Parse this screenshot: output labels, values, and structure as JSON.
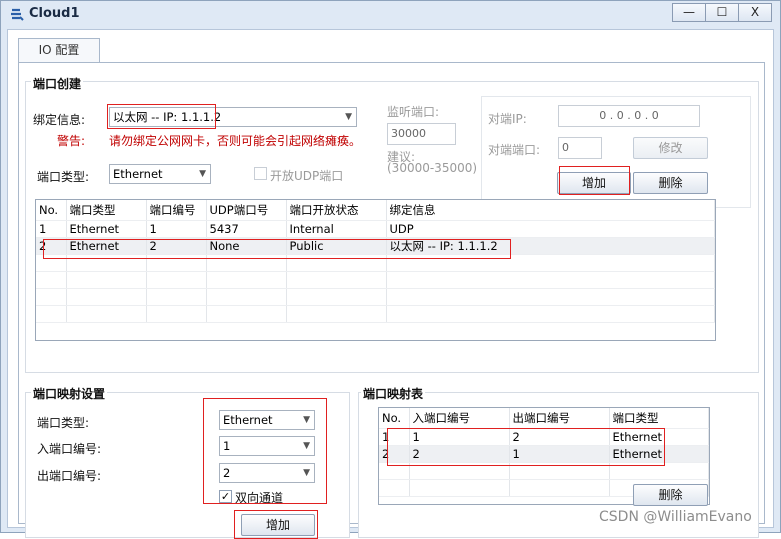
{
  "window": {
    "title": "Cloud1",
    "minimize": "—",
    "maximize": "☐",
    "close": "X"
  },
  "tab": {
    "label": "IO 配置"
  },
  "port_create": {
    "title": "端口创建",
    "bind_label": "绑定信息:",
    "bind_value": "以太网 -- IP: 1.1.1.2",
    "warning_label": "警告:",
    "warning_text": "请勿绑定公网网卡，否则可能会引起网络瘫痪。",
    "port_type_label": "端口类型:",
    "port_type_value": "Ethernet",
    "udp_open_label": "开放UDP端口",
    "listen_label": "监听端口:",
    "listen_value": "30000",
    "suggest_label": "建议:",
    "suggest_range": "(30000-35000)",
    "peer_ip_label": "对端IP:",
    "peer_ip_value": "0 . 0 . 0 . 0",
    "peer_port_label": "对端端口:",
    "peer_port_value": "0",
    "modify_label": "修改",
    "add_label": "增加",
    "delete_label": "删除",
    "table": {
      "headers": [
        "No.",
        "端口类型",
        "端口编号",
        "UDP端口号",
        "端口开放状态",
        "绑定信息"
      ],
      "rows": [
        [
          "1",
          "Ethernet",
          "1",
          "5437",
          "Internal",
          "UDP"
        ],
        [
          "2",
          "Ethernet",
          "2",
          "None",
          "Public",
          "以太网 -- IP: 1.1.1.2"
        ]
      ]
    }
  },
  "mapping_settings": {
    "title": "端口映射设置",
    "port_type_label": "端口类型:",
    "port_type_value": "Ethernet",
    "in_label": "入端口编号:",
    "in_value": "1",
    "out_label": "出端口编号:",
    "out_value": "2",
    "bidirectional_label": "双向通道",
    "add_label": "增加"
  },
  "mapping_table": {
    "title": "端口映射表",
    "headers": [
      "No.",
      "入端口编号",
      "出端口编号",
      "端口类型"
    ],
    "rows": [
      [
        "1",
        "1",
        "2",
        "Ethernet"
      ],
      [
        "2",
        "2",
        "1",
        "Ethernet"
      ]
    ],
    "delete_label": "删除"
  },
  "watermark": "CSDN @WilliamEvano",
  "colors": {
    "highlight_box": "#e02020",
    "warning": "#c00000",
    "frame": "#dfe9f5"
  }
}
